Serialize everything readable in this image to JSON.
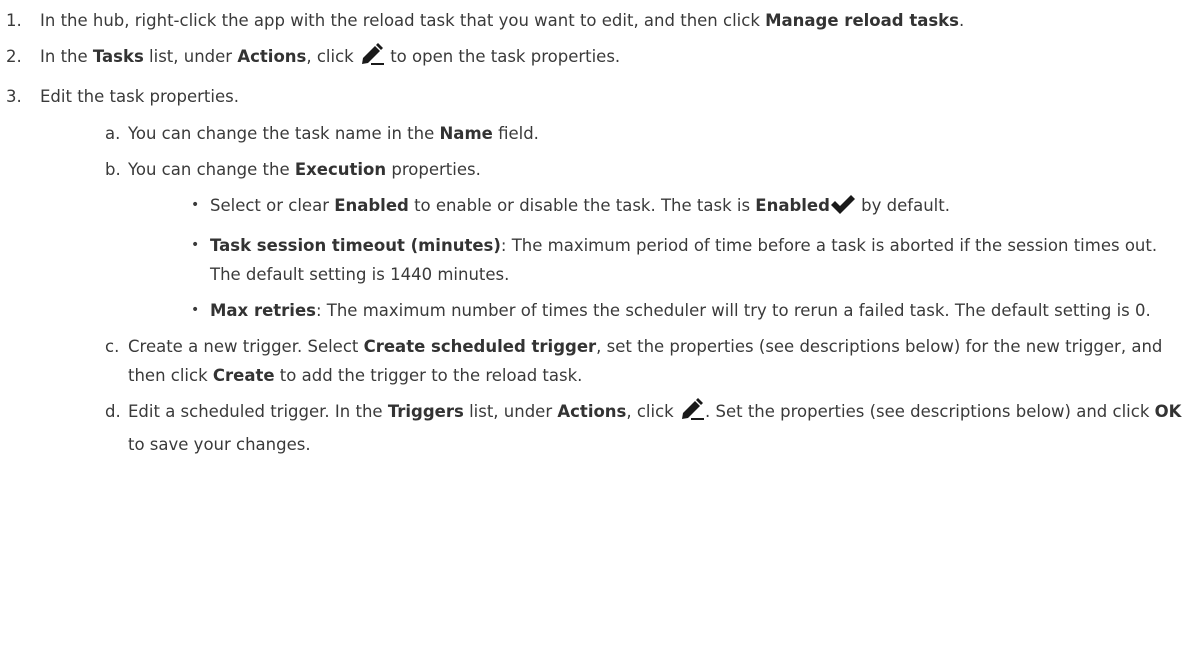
{
  "steps": [
    {
      "number": "1.",
      "prefix": "In the hub, right-click the app with the reload task that you want to edit, and then click ",
      "bold": "Manage reload tasks",
      "suffix": "."
    },
    {
      "number": "2.",
      "t1": "In the ",
      "b1": "Tasks",
      "t2": " list, under ",
      "b2": "Actions",
      "t3": ", click ",
      "t4": " to open the task properties.",
      "icon": "pencil-icon"
    },
    {
      "number": "3.",
      "text": "Edit the task properties."
    }
  ],
  "substeps": {
    "a": {
      "letter": "a.",
      "t1": "You can change the task name in the ",
      "b1": "Name",
      "t2": " field."
    },
    "b": {
      "letter": "b.",
      "t1": "You can change the ",
      "b1": "Execution",
      "t2": " properties."
    },
    "c": {
      "letter": "c.",
      "t1": "Create a new trigger. Select ",
      "b1": "Create scheduled trigger",
      "t2": ", set the properties (see descriptions below) for the new trigger, and then click ",
      "b2": "Create",
      "t3": " to add the trigger to the reload task."
    },
    "d": {
      "letter": "d.",
      "t1": "Edit a scheduled trigger. In the ",
      "b1": "Triggers",
      "t2": " list, under ",
      "b2": "Actions",
      "t3": ", click ",
      "t4": ". Set the properties (see descriptions below) and click ",
      "b3": "OK",
      "t5": " to save your changes.",
      "icon": "pencil-icon"
    }
  },
  "bullets": [
    {
      "symbol": "•",
      "t1": "Select or clear ",
      "b1": "Enabled",
      "t2": " to enable or disable the task. The task is ",
      "b2": "Enabled",
      "t3": " by default.",
      "icon": "checkmark-icon"
    },
    {
      "symbol": "•",
      "b1": "Task session timeout (minutes)",
      "t1": ": The maximum period of time before a task is aborted if the session times out. The default setting is 1440 minutes."
    },
    {
      "symbol": "•",
      "b1": "Max retries",
      "t1": ": The maximum number of times the scheduler will try to rerun a failed task. The default setting is 0."
    }
  ]
}
